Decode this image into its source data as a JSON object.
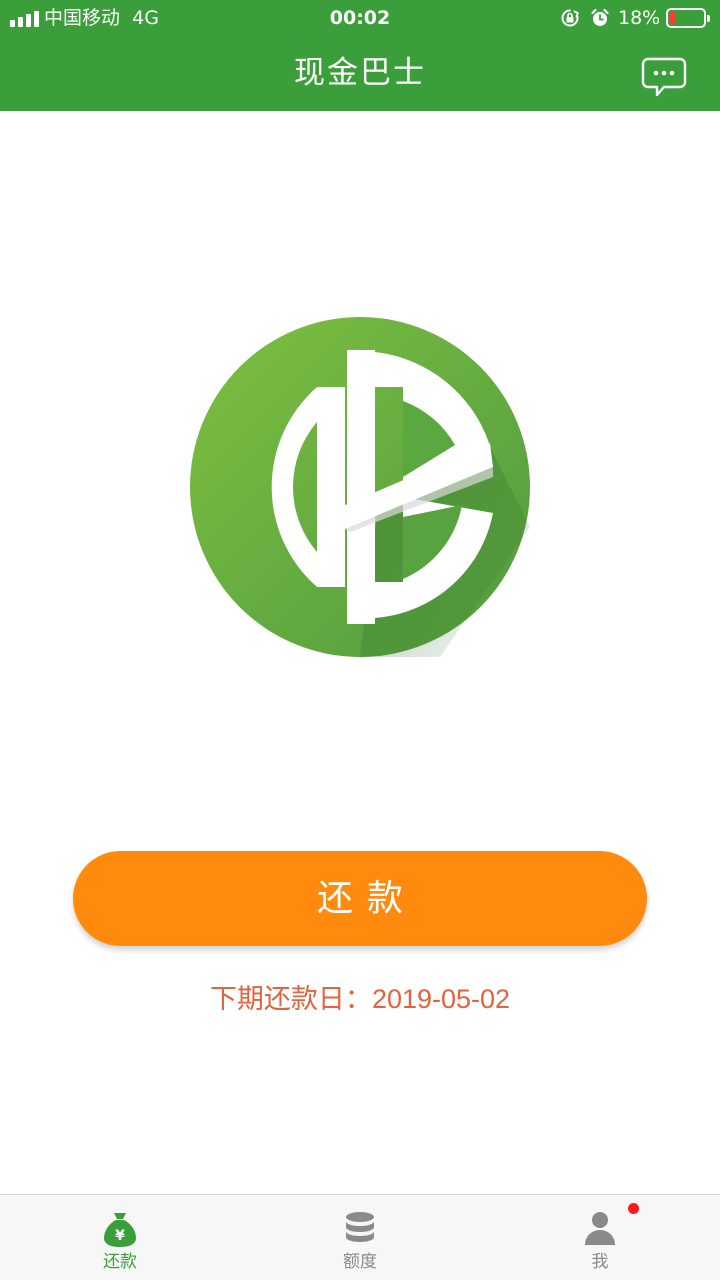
{
  "status_bar": {
    "carrier": "中国移动",
    "network": "4G",
    "time": "00:02",
    "battery_percent": "18%",
    "icons": [
      "signal-icon",
      "orientation-lock-icon",
      "alarm-icon",
      "battery-icon"
    ]
  },
  "header": {
    "title": "现金巴士",
    "message_icon": "chat-bubble-icon"
  },
  "main": {
    "logo": "app-logo",
    "repay_button_label": "还款",
    "next_due_label": "下期还款日：",
    "next_due_date": "2019-05-02"
  },
  "tabbar": {
    "tabs": [
      {
        "label": "还款",
        "icon": "money-bag-icon",
        "active": true
      },
      {
        "label": "额度",
        "icon": "database-coins-icon",
        "active": false
      },
      {
        "label": "我",
        "icon": "person-icon",
        "active": false,
        "badge": true
      }
    ]
  },
  "colors": {
    "brand_green": "#3a9f3a",
    "button_orange": "#ff8a0d",
    "due_text": "#e4623c",
    "badge_red": "#ff1a1a"
  }
}
